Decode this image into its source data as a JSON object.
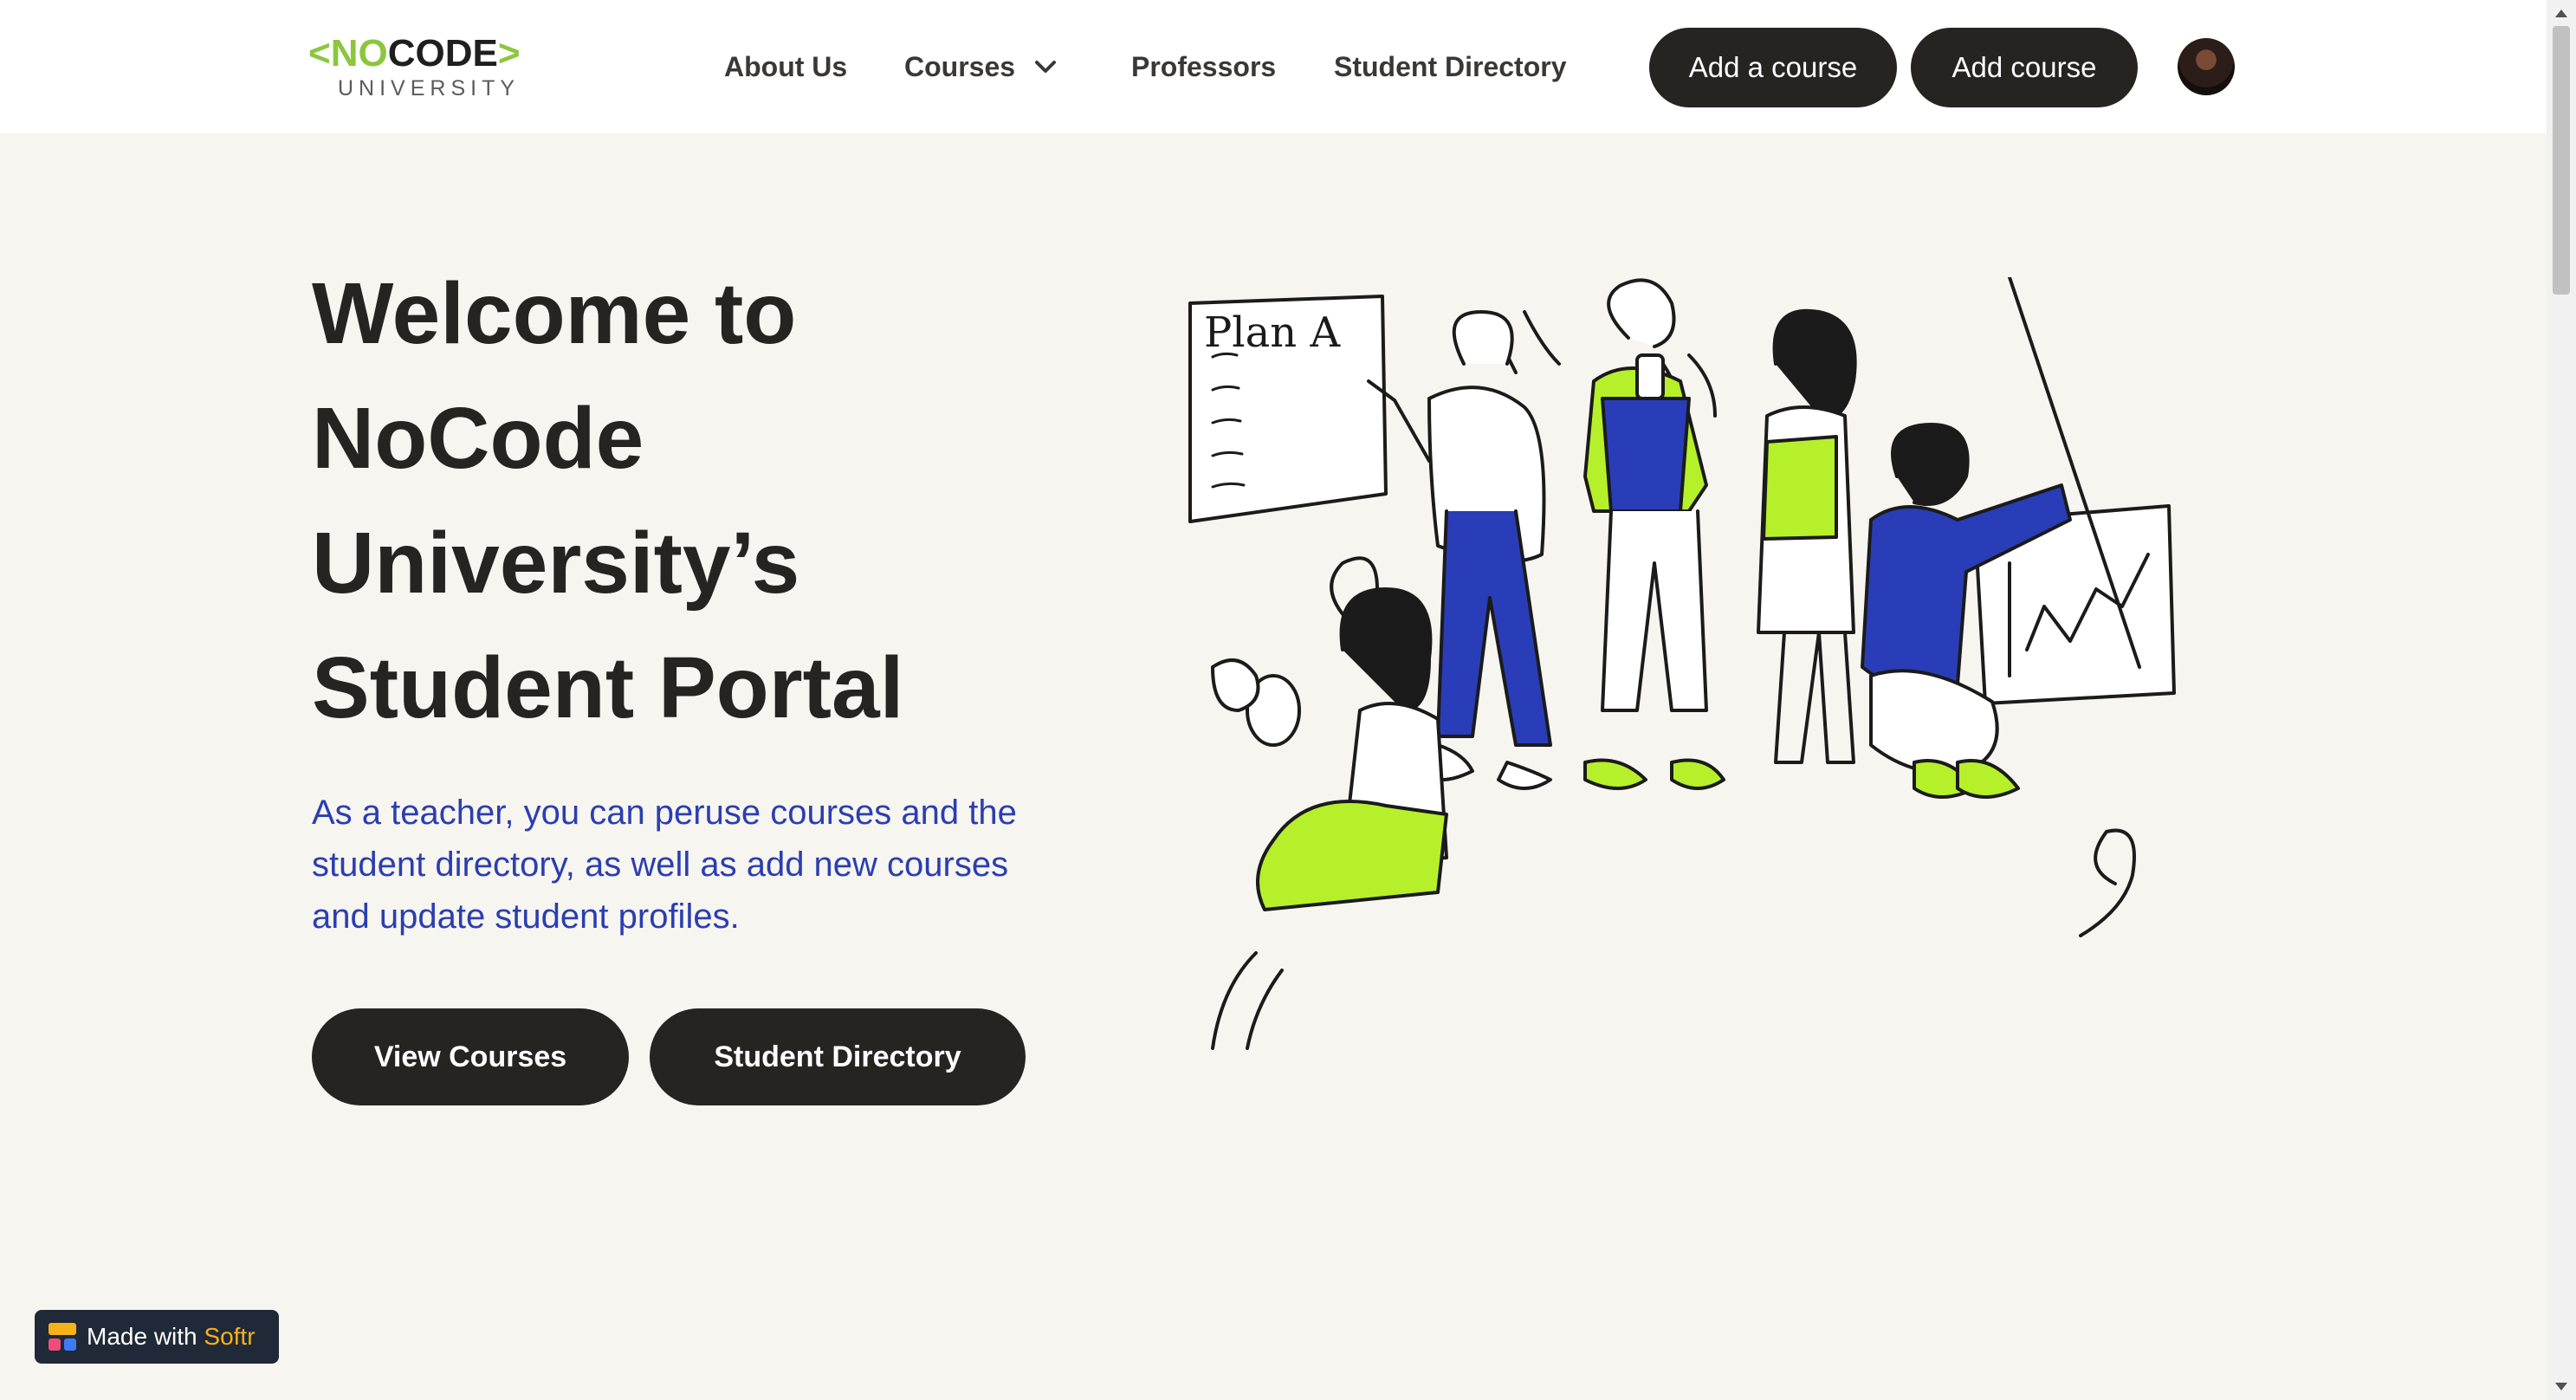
{
  "logo": {
    "left_chevron": "<",
    "brand_lime": "NO",
    "brand_dark": "CODE",
    "right_chevron": ">",
    "subtitle": "UNIVERSITY"
  },
  "nav": {
    "items": [
      {
        "label": "About Us"
      },
      {
        "label": "Courses"
      },
      {
        "label": "Professors"
      },
      {
        "label": "Student Directory"
      }
    ]
  },
  "header_buttons": {
    "add_a_course": "Add a course",
    "add_course": "Add course"
  },
  "hero": {
    "title_lines": [
      "Welcome to",
      "NoCode",
      "University’s",
      "Student Portal"
    ],
    "description": "As a teacher, you can peruse courses and the student directory, as well as add new courses and update student profiles.",
    "cta_primary": "View Courses",
    "cta_secondary": "Student Directory"
  },
  "illustration": {
    "whiteboard_text": "Plan A",
    "icon": "students-group-illustration"
  },
  "badge": {
    "prefix": "Made with",
    "brand": "Softr"
  },
  "colors": {
    "accent_lime": "#8cc63f",
    "accent_blue": "#2b3eb0",
    "illustration_lime": "#b6f02a",
    "illustration_blue": "#2a3db8",
    "dark": "#262421",
    "background": "#f7f5f0",
    "softr_orange": "#f7b21a"
  }
}
